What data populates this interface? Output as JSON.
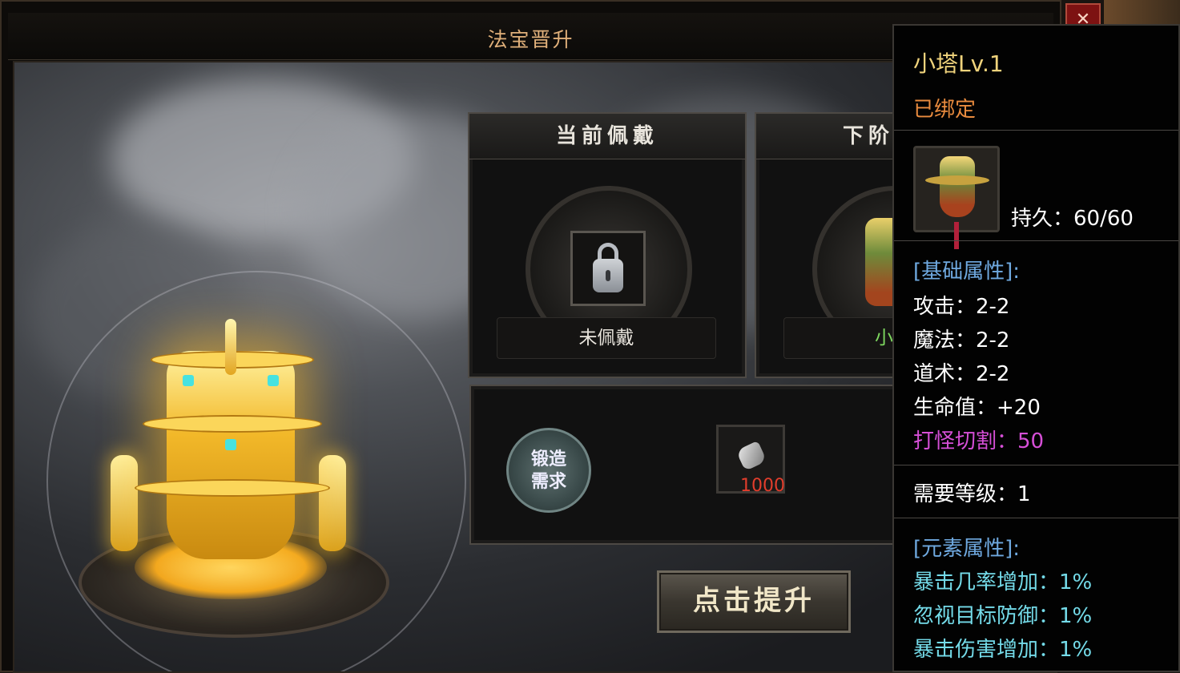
{
  "window": {
    "title": "法宝晋升",
    "close_icon": "close-icon",
    "close_glyph": "✕"
  },
  "current": {
    "header": "当前佩戴",
    "slot_icon": "lock-icon",
    "name": "未佩戴"
  },
  "next": {
    "header": "下阶",
    "name": "小塔",
    "name_color": "#7ed85f"
  },
  "forge": {
    "badge_line1": "锻造",
    "badge_line2": "需求",
    "material_icon": "ore-icon",
    "material_count": "1000",
    "count_color": "#e23d2c"
  },
  "upgrade_button": {
    "label": "点击提升"
  },
  "tooltip": {
    "item_name": "小塔Lv.1",
    "bind_status": "已绑定",
    "item_icon": "pagoda-icon",
    "durability": "持久：60/60",
    "base_header": "[基础属性]:",
    "base_stats": [
      "攻击：2-2",
      "魔法：2-2",
      "道术：2-2",
      "生命值：+20"
    ],
    "special_stat": "打怪切割：50",
    "required_level": "需要等级：1",
    "element_header": "[元素属性]:",
    "element_stats": [
      "暴击几率增加：1%",
      "忽视目标防御：1%",
      "暴击伤害增加：1%"
    ],
    "colors": {
      "name": "#f0d37c",
      "bind": "#e98b3e",
      "header": "#6fa9e0",
      "special": "#d64fd7",
      "element": "#74dbe9",
      "normal": "#ffffff"
    }
  }
}
